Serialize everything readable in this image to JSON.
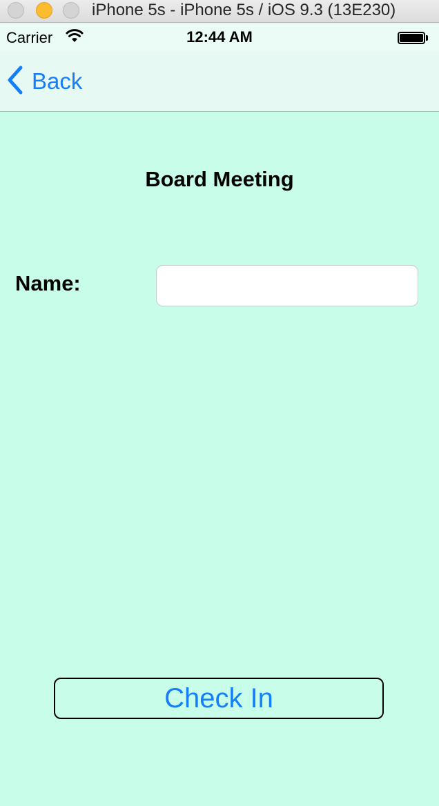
{
  "window": {
    "title": "iPhone 5s - iPhone 5s / iOS 9.3 (13E230)"
  },
  "status_bar": {
    "carrier": "Carrier",
    "time": "12:44 AM"
  },
  "nav": {
    "back_label": "Back"
  },
  "main": {
    "title": "Board Meeting",
    "name_label": "Name:",
    "name_value": "",
    "checkin_label": "Check In"
  },
  "colors": {
    "background": "#c8fde9",
    "accent": "#157efb"
  },
  "icons": [
    "close-button",
    "minimize-button",
    "zoom-button",
    "wifi-icon",
    "battery-icon",
    "chevron-left-icon"
  ]
}
